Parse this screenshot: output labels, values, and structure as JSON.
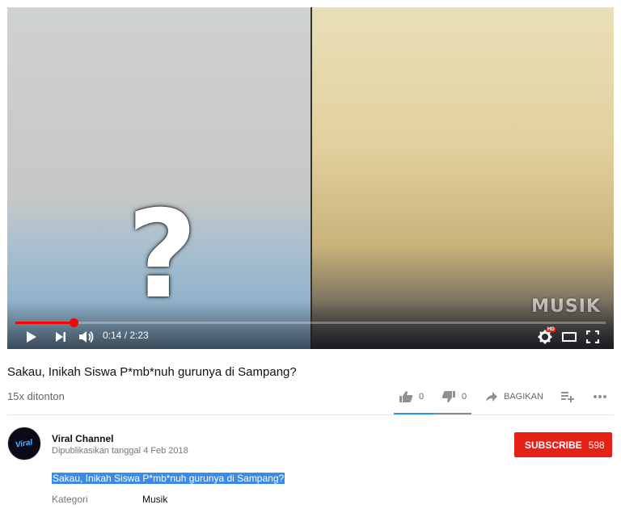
{
  "player": {
    "overlay_symbol": "?",
    "watermark": "MUSIK",
    "time_display": "0:14 / 2:23",
    "progress": 0.098,
    "icons": {
      "play": "play-icon",
      "next": "next-icon",
      "volume": "volume-icon",
      "settings": "gear-icon",
      "theater": "theater-icon",
      "fullscreen": "fullscreen-icon"
    },
    "hd_badge": "HD",
    "accent_color": "#ff0000"
  },
  "video": {
    "title": "Sakau, Inikah Siswa P*mb*nuh gurunya di Sampang?",
    "views": "15x ditonton"
  },
  "actions": {
    "like_count": "0",
    "dislike_count": "0",
    "share_label": "BAGIKAN"
  },
  "channel": {
    "name": "Viral Channel",
    "avatar_text": "Viral",
    "published": "Dipublikasikan tanggal 4 Feb 2018",
    "subscribe_label": "SUBSCRIBE",
    "subscriber_count": "598",
    "subscribe_color": "#e62117"
  },
  "description": {
    "text": "Sakau, Inikah Siswa P*mb*nuh gurunya di Sampang?",
    "category_label": "Kategori",
    "category_value": "Musik"
  }
}
